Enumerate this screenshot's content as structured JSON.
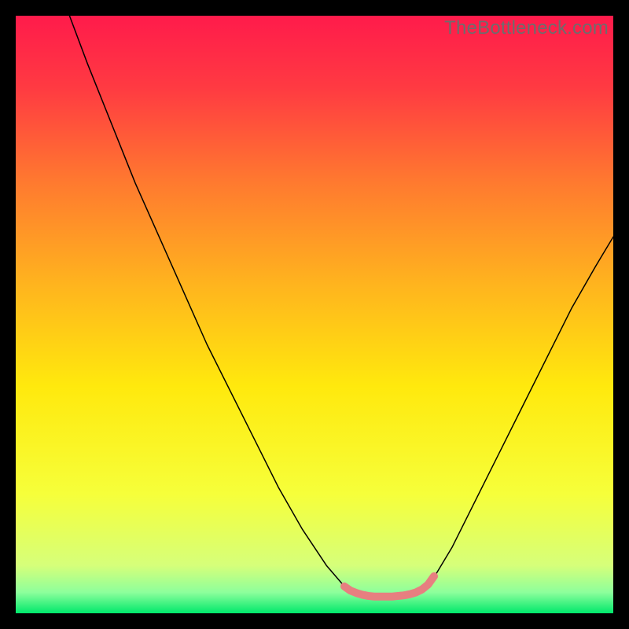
{
  "watermark": "TheBottleneck.com",
  "chart_data": {
    "type": "line",
    "title": "",
    "xlabel": "",
    "ylabel": "",
    "xlim": [
      0,
      100
    ],
    "ylim": [
      0,
      100
    ],
    "background_gradient": {
      "stops": [
        {
          "offset": 0.0,
          "color": "#ff1b4b"
        },
        {
          "offset": 0.12,
          "color": "#ff3a42"
        },
        {
          "offset": 0.28,
          "color": "#ff7a2f"
        },
        {
          "offset": 0.45,
          "color": "#ffb41e"
        },
        {
          "offset": 0.62,
          "color": "#ffe90d"
        },
        {
          "offset": 0.8,
          "color": "#f6ff3a"
        },
        {
          "offset": 0.92,
          "color": "#d6ff7a"
        },
        {
          "offset": 0.965,
          "color": "#8dff9c"
        },
        {
          "offset": 1.0,
          "color": "#00e86b"
        }
      ]
    },
    "series": [
      {
        "name": "left-curve",
        "color": "#000000",
        "width": 1.5,
        "x": [
          9,
          12,
          16,
          20,
          24,
          28,
          32,
          36,
          40,
          44,
          48,
          52,
          55,
          57
        ],
        "y": [
          100,
          92,
          82,
          72,
          63,
          54,
          45,
          37,
          29,
          21,
          14,
          8,
          4.5,
          3.4
        ]
      },
      {
        "name": "right-curve",
        "color": "#000000",
        "width": 1.5,
        "x": [
          68,
          70,
          73,
          77,
          81,
          85,
          89,
          93,
          97,
          100
        ],
        "y": [
          3.4,
          6,
          11,
          19,
          27,
          35,
          43,
          51,
          58,
          63
        ]
      },
      {
        "name": "bottom-highlight",
        "color": "#e77f80",
        "width": 10,
        "x": [
          55,
          56,
          57,
          58,
          59,
          60,
          61,
          62,
          63,
          64,
          65,
          66,
          67,
          68,
          69,
          70
        ],
        "y": [
          4.5,
          3.8,
          3.4,
          3.1,
          2.9,
          2.8,
          2.8,
          2.8,
          2.8,
          2.9,
          3.0,
          3.2,
          3.5,
          4.0,
          4.8,
          6.2
        ]
      }
    ]
  }
}
